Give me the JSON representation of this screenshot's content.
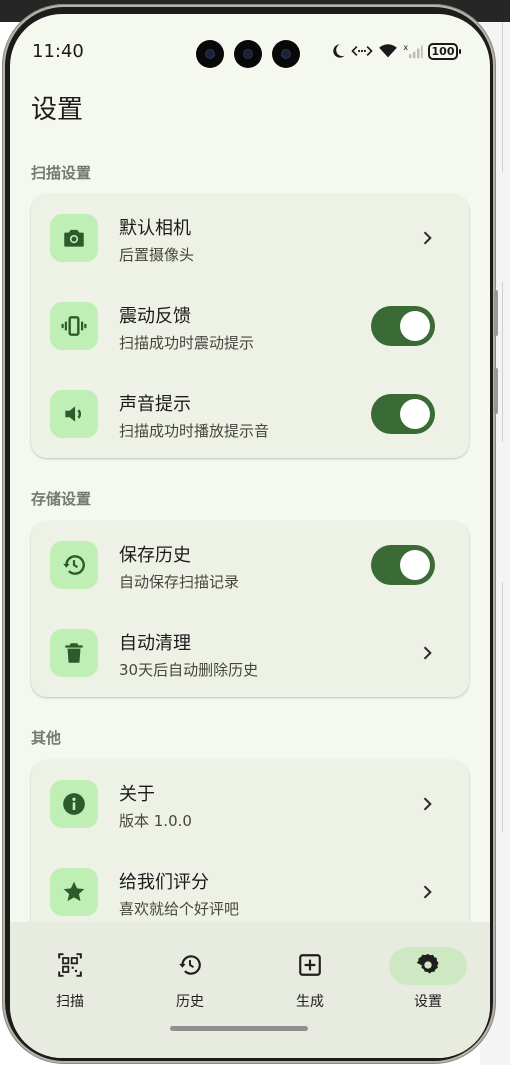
{
  "status_bar": {
    "time": "11:40",
    "battery": "100"
  },
  "page": {
    "title": "设置"
  },
  "sections": [
    {
      "label": "扫描设置",
      "items": [
        {
          "title": "默认相机",
          "subtitle": "后置摄像头",
          "icon": "camera-icon",
          "control": "chevron"
        },
        {
          "title": "震动反馈",
          "subtitle": "扫描成功时震动提示",
          "icon": "vibration-icon",
          "control": "toggle",
          "toggle_on": true
        },
        {
          "title": "声音提示",
          "subtitle": "扫描成功时播放提示音",
          "icon": "volume-icon",
          "control": "toggle",
          "toggle_on": true
        }
      ]
    },
    {
      "label": "存储设置",
      "items": [
        {
          "title": "保存历史",
          "subtitle": "自动保存扫描记录",
          "icon": "restore-history-icon",
          "control": "toggle",
          "toggle_on": true
        },
        {
          "title": "自动清理",
          "subtitle": "30天后自动删除历史",
          "icon": "trash-icon",
          "control": "chevron"
        }
      ]
    },
    {
      "label": "其他",
      "items": [
        {
          "title": "关于",
          "subtitle": "版本 1.0.0",
          "icon": "info-icon",
          "control": "chevron"
        },
        {
          "title": "给我们评分",
          "subtitle": "喜欢就给个好评吧",
          "icon": "star-icon",
          "control": "chevron"
        }
      ]
    }
  ],
  "bottom_nav": {
    "items": [
      {
        "label": "扫描",
        "icon": "qr-scan-icon",
        "active": false
      },
      {
        "label": "历史",
        "icon": "history-icon",
        "active": false
      },
      {
        "label": "生成",
        "icon": "add-box-icon",
        "active": false
      },
      {
        "label": "设置",
        "icon": "gear-icon",
        "active": true
      }
    ]
  },
  "colors": {
    "accent": "#3a6b36",
    "icon_bg": "#bfefb4",
    "card_bg": "#eef2e6",
    "screen_bg": "#f4f8ee",
    "nav_active_pill": "#cfe8c4"
  }
}
